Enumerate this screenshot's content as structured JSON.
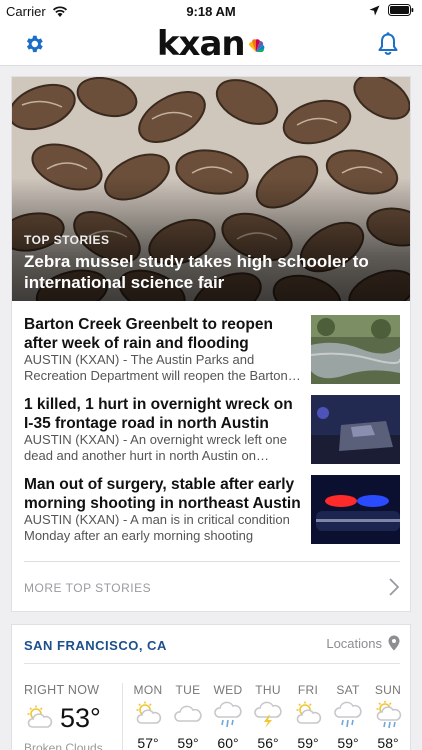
{
  "status_bar": {
    "carrier": "Carrier",
    "time": "9:18 AM"
  },
  "nav": {
    "logo": "kxan"
  },
  "hero": {
    "kicker": "TOP STORIES",
    "title": "Zebra mussel study takes high schooler to international science fair"
  },
  "stories": [
    {
      "title": "Barton Creek Greenbelt to reopen after week of rain and flooding",
      "summary": "AUSTIN (KXAN) - The Austin Parks and Recreation Department will reopen the Barton Creek Greenbelt"
    },
    {
      "title": "1 killed, 1 hurt in overnight wreck on I-35 frontage road in north Austin",
      "summary": "AUSTIN (KXAN) - An overnight wreck left one dead and another hurt in north Austin on Monday"
    },
    {
      "title": "Man out of surgery, stable after early morning shooting in northeast Austin",
      "summary": "AUSTIN (KXAN) - A man is in critical condition Monday after an early morning shooting"
    }
  ],
  "more_label": "MORE TOP STORIES",
  "weather": {
    "location": "SAN FRANCISCO, CA",
    "locations_label": "Locations",
    "now_label": "RIGHT NOW",
    "now_temp": "53°",
    "now_condition": "Broken Clouds",
    "now_icon": "partly-cloudy-icon",
    "days": [
      {
        "name": "MON",
        "temp": "57°",
        "icon": "partly-cloudy-icon"
      },
      {
        "name": "TUE",
        "temp": "59°",
        "icon": "cloud-icon"
      },
      {
        "name": "WED",
        "temp": "60°",
        "icon": "rain-icon"
      },
      {
        "name": "THU",
        "temp": "56°",
        "icon": "thunderstorm-icon"
      },
      {
        "name": "FRI",
        "temp": "59°",
        "icon": "partly-cloudy-icon"
      },
      {
        "name": "SAT",
        "temp": "59°",
        "icon": "rain-icon"
      },
      {
        "name": "SUN",
        "temp": "58°",
        "icon": "sun-rain-icon"
      }
    ]
  },
  "colors": {
    "accent": "#1c6fc9",
    "weather_location": "#1c4f8c",
    "icon_gray": "#c8c8cc",
    "sun_yellow": "#f2c531"
  }
}
